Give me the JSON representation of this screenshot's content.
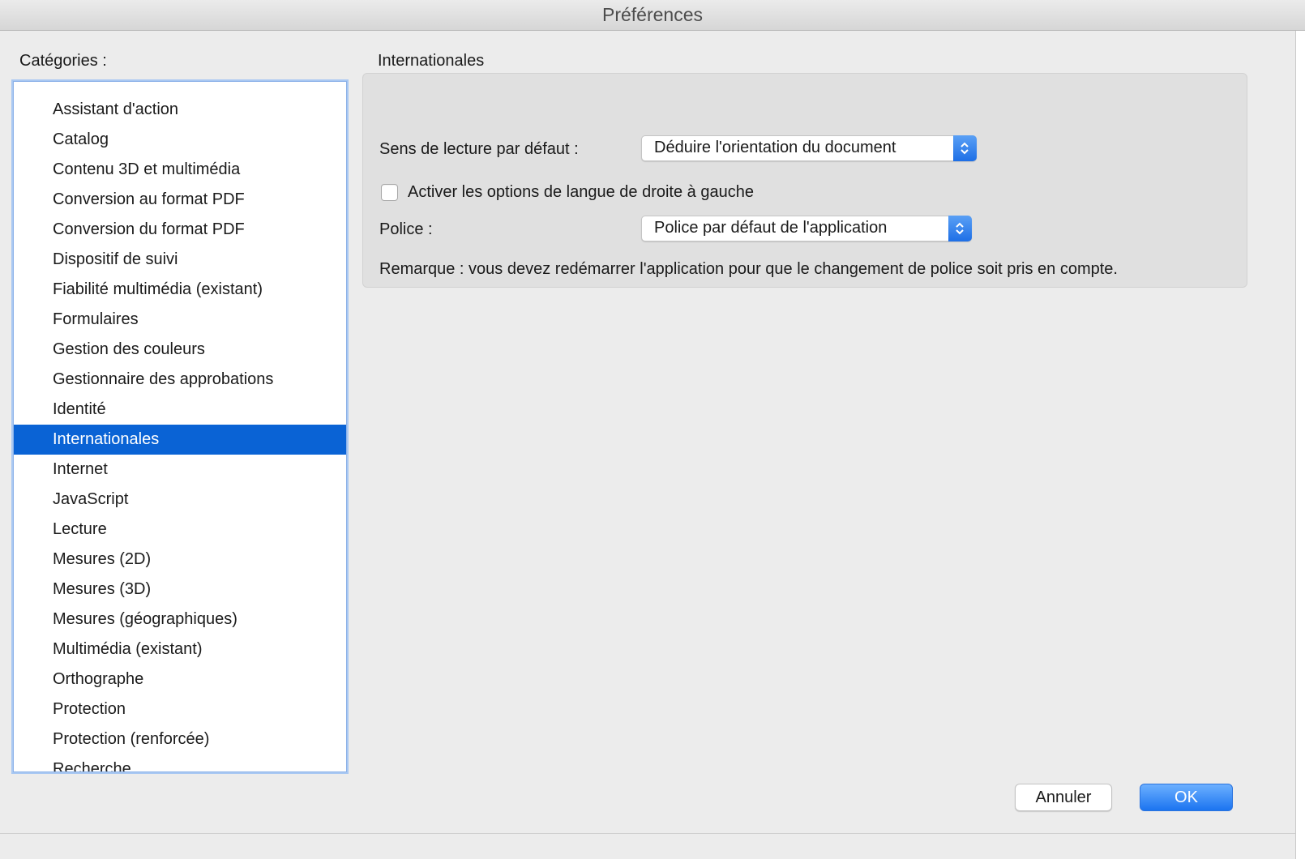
{
  "window": {
    "title": "Préférences"
  },
  "categories": {
    "label": "Catégories :",
    "items": [
      "Assistant d'action",
      "Catalog",
      "Contenu 3D et multimédia",
      "Conversion au format PDF",
      "Conversion du format PDF",
      "Dispositif de suivi",
      "Fiabilité multimédia (existant)",
      "Formulaires",
      "Gestion des couleurs",
      "Gestionnaire des approbations",
      "Identité",
      "Internationales",
      "Internet",
      "JavaScript",
      "Lecture",
      "Mesures (2D)",
      "Mesures (3D)",
      "Mesures (géographiques)",
      "Multimédia (existant)",
      "Orthographe",
      "Protection",
      "Protection (renforcée)",
      "Recherche"
    ],
    "selected": "Internationales"
  },
  "panel": {
    "title": "Internationales",
    "reading_direction": {
      "label": "Sens de lecture par défaut :",
      "value": "Déduire l'orientation du document"
    },
    "rtl_checkbox": {
      "label": "Activer les options de langue de droite à gauche",
      "checked": false
    },
    "font": {
      "label": "Police :",
      "value": "Police par défaut de l'application"
    },
    "note": "Remarque : vous devez redémarrer l'application pour que le changement de police soit pris en compte."
  },
  "buttons": {
    "cancel": "Annuler",
    "ok": "OK"
  },
  "colors": {
    "accent": "#0a63d5",
    "ok_button": "#1b74f0",
    "list_focus_ring": "#a9c8f2"
  }
}
